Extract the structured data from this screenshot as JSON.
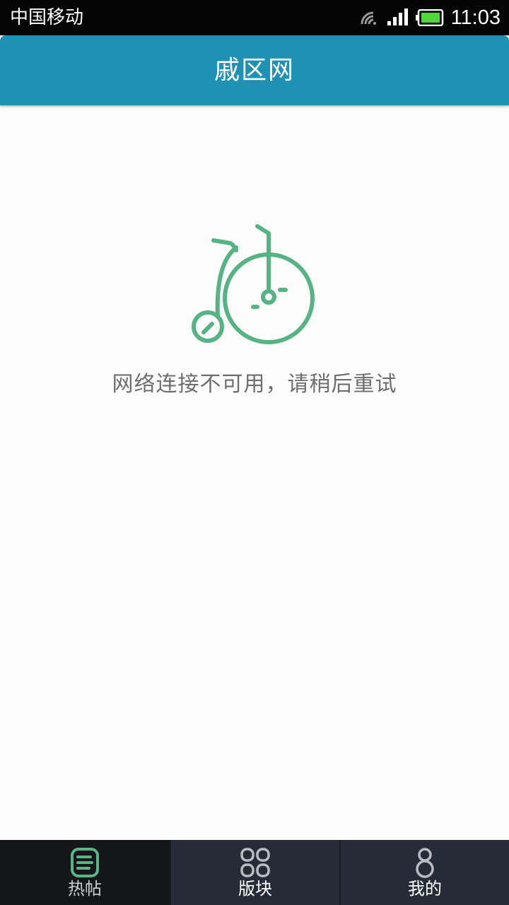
{
  "status_bar": {
    "carrier": "中国移动",
    "time": "11:03",
    "icons": [
      "wifi-icon",
      "signal-icon",
      "battery-icon"
    ]
  },
  "header": {
    "title": "戚区网",
    "color": "#1e91b5"
  },
  "empty_state": {
    "icon": "bicycle-icon",
    "message": "网络连接不可用，请稍后重试",
    "accent": "#56b383"
  },
  "bottom_nav": {
    "items": [
      {
        "label": "热帖",
        "icon": "hot-posts-icon",
        "active": true
      },
      {
        "label": "版块",
        "icon": "grid-icon",
        "active": false
      },
      {
        "label": "我的",
        "icon": "profile-icon",
        "active": false
      }
    ]
  }
}
